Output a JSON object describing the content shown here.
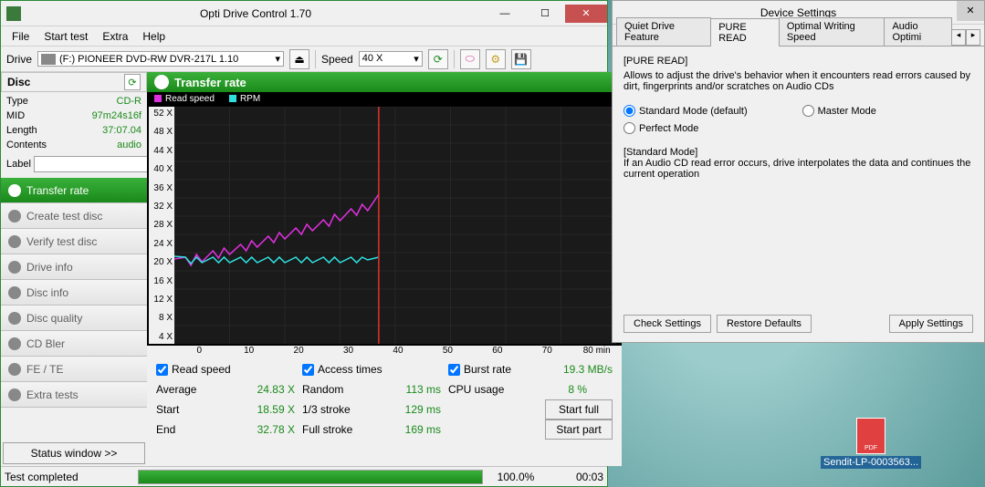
{
  "app": {
    "title": "Opti Drive Control 1.70",
    "menubar": [
      "File",
      "Start test",
      "Extra",
      "Help"
    ],
    "toolbar": {
      "drive_label": "Drive",
      "drive_value": "(F:)   PIONEER DVD-RW  DVR-217L 1.10",
      "speed_label": "Speed",
      "speed_value": "40 X"
    }
  },
  "disc": {
    "header": "Disc",
    "rows": [
      {
        "label": "Type",
        "value": "CD-R"
      },
      {
        "label": "MID",
        "value": "97m24s16f"
      },
      {
        "label": "Length",
        "value": "37:07.04"
      },
      {
        "label": "Contents",
        "value": "audio"
      }
    ],
    "label_label": "Label",
    "label_value": ""
  },
  "nav": [
    "Transfer rate",
    "Create test disc",
    "Verify test disc",
    "Drive info",
    "Disc info",
    "Disc quality",
    "CD Bler",
    "FE / TE",
    "Extra tests"
  ],
  "nav_active_index": 0,
  "status_window_btn": "Status window >>",
  "content": {
    "title": "Transfer rate",
    "legend": {
      "read": "Read speed",
      "rpm": "RPM"
    },
    "colors": {
      "read": "#e030e0",
      "rpm": "#30e0e0"
    },
    "checkboxes": {
      "read": "Read speed",
      "access": "Access times",
      "burst": "Burst rate"
    },
    "burst_value": "19.3 MB/s",
    "metrics": {
      "average": {
        "label": "Average",
        "value": "24.83 X"
      },
      "start": {
        "label": "Start",
        "value": "18.59 X"
      },
      "end": {
        "label": "End",
        "value": "32.78 X"
      },
      "random": {
        "label": "Random",
        "value": "113 ms"
      },
      "third": {
        "label": "1/3 stroke",
        "value": "129 ms"
      },
      "full": {
        "label": "Full stroke",
        "value": "169 ms"
      },
      "cpu": {
        "label": "CPU usage",
        "value": "8 %"
      }
    },
    "start_full": "Start full",
    "start_part": "Start part"
  },
  "statusbar": {
    "text": "Test completed",
    "percent": 100,
    "percent_label": "100.0%",
    "time": "00:03"
  },
  "settings": {
    "title": "Device Settings",
    "tabs": [
      "Quiet Drive Feature",
      "PURE READ",
      "Optimal Writing Speed",
      "Audio Optimi"
    ],
    "active_tab": 1,
    "section_title": "[PURE READ]",
    "section_desc": "Allows to adjust the drive's behavior when it encounters read errors caused by dirt, fingerprints and/or scratches on Audio CDs",
    "options": [
      {
        "label": "Standard Mode (default)",
        "checked": true
      },
      {
        "label": "Master Mode",
        "checked": false
      },
      {
        "label": "Perfect Mode",
        "checked": false
      }
    ],
    "mode_title": "[Standard Mode]",
    "mode_desc": "If an Audio CD read error occurs, drive interpolates the data and continues the current operation",
    "buttons": {
      "check": "Check Settings",
      "restore": "Restore Defaults",
      "apply": "Apply Settings"
    }
  },
  "desktop": {
    "file_label": "Sendit-LP-0003563..."
  },
  "chart_data": {
    "type": "line",
    "xlabel": "min",
    "ylabel": "X",
    "xlim": [
      0,
      80
    ],
    "ylim": [
      0,
      52
    ],
    "x_ticks": [
      0,
      10,
      20,
      30,
      40,
      50,
      60,
      70,
      80
    ],
    "y_ticks": [
      4,
      8,
      12,
      16,
      20,
      24,
      28,
      32,
      36,
      40,
      44,
      48,
      52
    ],
    "x_end_marker": 37,
    "series": [
      {
        "name": "Read speed",
        "color": "#e030e0",
        "x": [
          0,
          2,
          3,
          4,
          5,
          7,
          8,
          9,
          10,
          12,
          13,
          14,
          15,
          17,
          18,
          19,
          20,
          22,
          23,
          24,
          25,
          27,
          28,
          29,
          30,
          32,
          33,
          34,
          35,
          37
        ],
        "values": [
          18.6,
          19.0,
          17.2,
          19.6,
          18.0,
          20.4,
          18.8,
          21.0,
          19.6,
          21.8,
          20.4,
          22.6,
          21.2,
          23.6,
          22.2,
          24.4,
          23.0,
          25.4,
          24.0,
          26.2,
          24.8,
          27.2,
          25.8,
          28.4,
          27.0,
          29.6,
          28.2,
          30.6,
          29.2,
          32.8
        ]
      },
      {
        "name": "RPM",
        "color": "#30e0e0",
        "x": [
          0,
          2,
          3,
          4,
          5,
          7,
          8,
          9,
          10,
          12,
          13,
          14,
          15,
          17,
          18,
          19,
          20,
          22,
          23,
          24,
          25,
          27,
          28,
          29,
          30,
          32,
          33,
          34,
          35,
          37
        ],
        "values": [
          19.2,
          19.0,
          17.6,
          19.0,
          17.8,
          19.0,
          17.8,
          19.0,
          17.8,
          19.0,
          17.8,
          19.0,
          17.8,
          19.0,
          17.8,
          19.0,
          17.8,
          19.0,
          17.8,
          19.0,
          17.8,
          19.0,
          17.8,
          19.0,
          17.8,
          19.0,
          17.8,
          19.0,
          18.4,
          19.0
        ]
      }
    ]
  }
}
